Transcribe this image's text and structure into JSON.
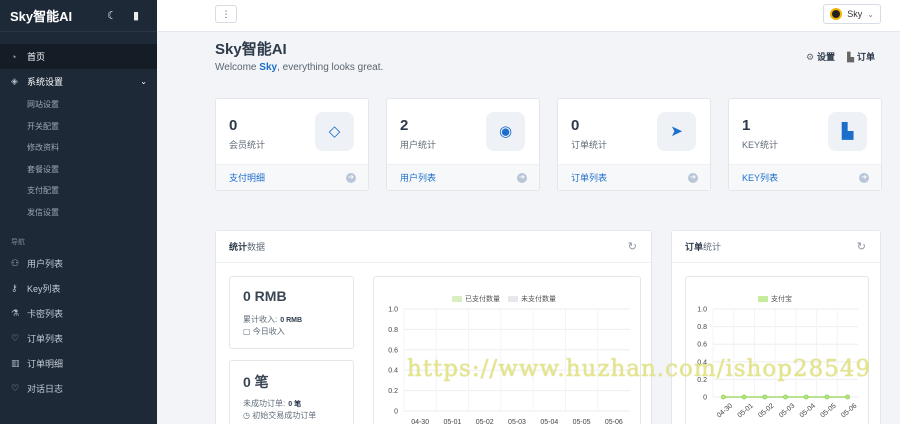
{
  "app": {
    "logo": "Sky智能AI"
  },
  "sidebar": {
    "items": [
      {
        "label": "首页",
        "icon": "dashboard-icon"
      },
      {
        "label": "系统设置",
        "icon": "layers-icon"
      }
    ],
    "subitems": [
      "网站设置",
      "开关配置",
      "修改资料",
      "套餐设置",
      "支付配置",
      "发信设置"
    ],
    "section_label": "导航",
    "nav_items": [
      {
        "label": "用户列表",
        "icon": "users-icon"
      },
      {
        "label": "Key列表",
        "icon": "key-icon"
      },
      {
        "label": "卡密列表",
        "icon": "lab-icon"
      },
      {
        "label": "订单列表",
        "icon": "heart-icon"
      },
      {
        "label": "订单明细",
        "icon": "columns-icon"
      },
      {
        "label": "对话日志",
        "icon": "heart-icon"
      }
    ]
  },
  "topbar": {
    "menu_glyph": "⋮",
    "user_name": "Sky"
  },
  "header": {
    "title": "Sky智能AI",
    "welcome_prefix": "Welcome ",
    "welcome_user": "Sky",
    "welcome_suffix": ", everything looks great.",
    "settings_label": "设置",
    "orders_label": "订单"
  },
  "cards": [
    {
      "value": "0",
      "label": "会员统计",
      "link": "支付明细",
      "icon": "diamond-icon"
    },
    {
      "value": "2",
      "label": "用户统计",
      "link": "用户列表",
      "icon": "user-circle-icon"
    },
    {
      "value": "0",
      "label": "订单统计",
      "link": "订单列表",
      "icon": "send-icon"
    },
    {
      "value": "1",
      "label": "KEY统计",
      "link": "KEY列表",
      "icon": "bar-chart-icon"
    }
  ],
  "stats_panel": {
    "title_bold": "统计",
    "title_rest": "数据",
    "revenue": {
      "amount": "0 RMB",
      "line1_label": "累计收入:",
      "line1_value": "0 RMB",
      "line2": "今日收入"
    },
    "orders": {
      "amount": "0 笔",
      "line1_label": "未成功订单:",
      "line1_value": "0 笔",
      "line2": "初始交易成功订单"
    }
  },
  "orders_panel": {
    "title_bold": "订单",
    "title_rest": "统计"
  },
  "colors": {
    "paid": "#d9efc2",
    "unpaid": "#e6e8eb",
    "payments": "#c4ec9a",
    "accent": "#1b6ecc"
  },
  "watermark": "https://www.huzhan.com/ishop28549",
  "chart_data": [
    {
      "type": "bar",
      "categories": [
        "04-30",
        "05-01",
        "05-02",
        "05-03",
        "05-04",
        "05-05",
        "05-06"
      ],
      "series": [
        {
          "name": "已支付数量",
          "values": [
            0,
            0,
            0,
            0,
            0,
            0,
            0
          ]
        },
        {
          "name": "未支付数量",
          "values": [
            0,
            0,
            0,
            0,
            0,
            0,
            0
          ]
        }
      ],
      "yticks": [
        "1.0",
        "0.8",
        "0.6",
        "0.4",
        "0.2",
        "0"
      ],
      "ylim": [
        0,
        1.0
      ],
      "legend": "top",
      "grid": true
    },
    {
      "type": "line",
      "categories": [
        "04-30",
        "05-01",
        "05-02",
        "05-03",
        "05-04",
        "05-05",
        "05-06"
      ],
      "series": [
        {
          "name": "支付宝",
          "values": [
            0,
            0,
            0,
            0,
            0,
            0,
            0
          ]
        }
      ],
      "yticks": [
        "1.0",
        "0.8",
        "0.6",
        "0.4",
        "0.2",
        "0"
      ],
      "ylim": [
        0,
        1.0
      ],
      "legend": "top",
      "grid": true
    }
  ]
}
